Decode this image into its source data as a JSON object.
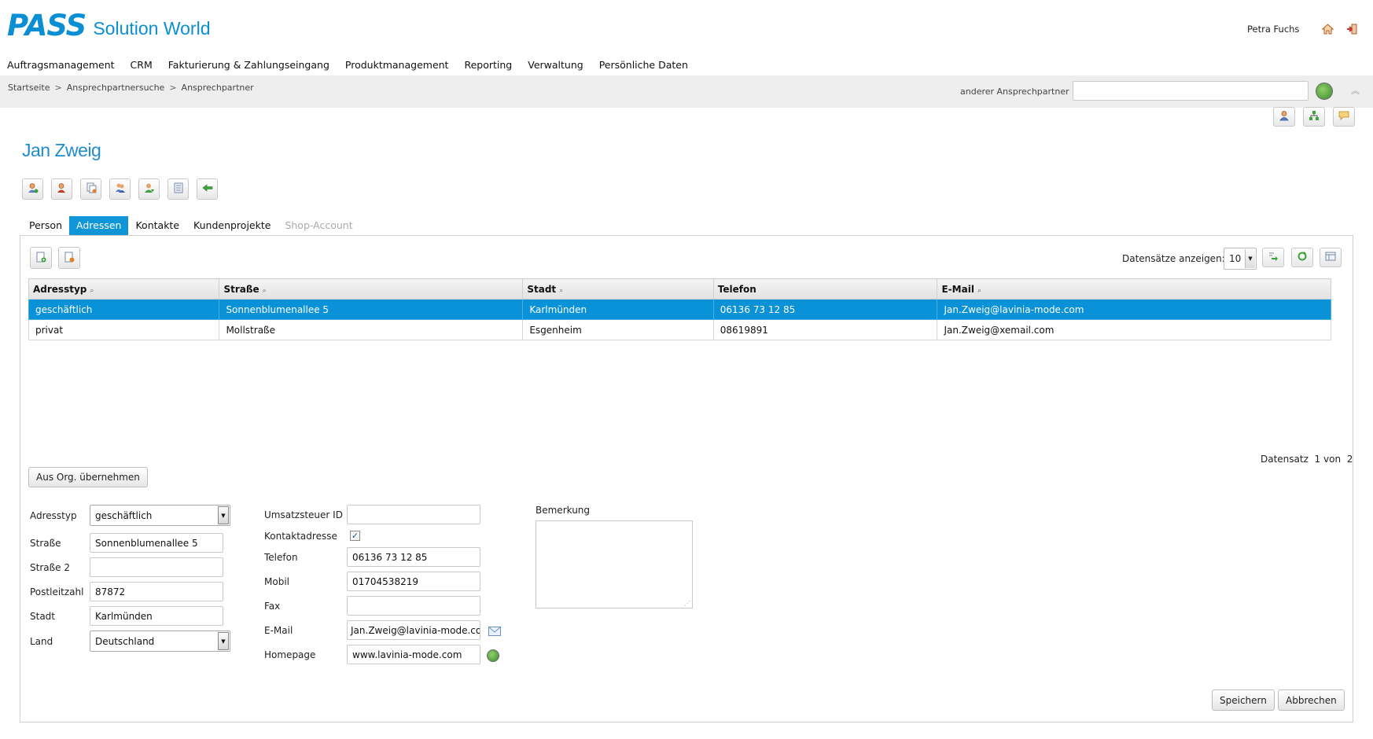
{
  "header": {
    "logo_mark": "PASS",
    "logo_text": "Solution World",
    "user_name": "Petra Fuchs",
    "home_icon": "home-icon",
    "logout_icon": "logout-icon"
  },
  "nav": {
    "items": [
      "Auftragsmanagement",
      "CRM",
      "Fakturierung & Zahlungseingang",
      "Produktmanagement",
      "Reporting",
      "Verwaltung",
      "Persönliche Daten"
    ]
  },
  "breadcrumb": {
    "items": [
      "Startseite",
      "Ansprechpartnersuche",
      "Ansprechpartner"
    ],
    "separator": ">"
  },
  "other_contact": {
    "label": "anderer Ansprechpartner",
    "value": ""
  },
  "page": {
    "title": "Jan Zweig"
  },
  "tabs": [
    {
      "label": "Person",
      "state": "normal"
    },
    {
      "label": "Adressen",
      "state": "active"
    },
    {
      "label": "Kontakte",
      "state": "normal"
    },
    {
      "label": "Kundenprojekte",
      "state": "normal"
    },
    {
      "label": "Shop-Account",
      "state": "disabled"
    }
  ],
  "grid": {
    "records_label": "Datensätze anzeigen:",
    "records_value": "10",
    "columns": [
      "Adresstyp",
      "Straße",
      "Stadt",
      "Telefon",
      "E-Mail"
    ],
    "sortable": [
      true,
      true,
      true,
      false,
      true
    ],
    "sort_glyph": "⌕",
    "rows": [
      {
        "type": "geschäftlich",
        "street": "Sonnenblumenallee 5",
        "city": "Karlmünden",
        "phone": "06136 73 12 85",
        "email": "Jan.Zweig@lavinia-mode.com",
        "selected": true
      },
      {
        "type": "privat",
        "street": "Mollstraße",
        "city": "Esgenheim",
        "phone": "08619891",
        "email": "Jan.Zweig@xemail.com",
        "selected": false
      }
    ],
    "record_count_label": "Datensatz",
    "record_count_current": "1",
    "record_count_of": "von",
    "record_count_total": "2"
  },
  "from_org_button": "Aus Org. übernehmen",
  "form": {
    "address_type": {
      "label": "Adresstyp",
      "value": "geschäftlich"
    },
    "street": {
      "label": "Straße",
      "value": "Sonnenblumenallee 5"
    },
    "street2": {
      "label": "Straße 2",
      "value": ""
    },
    "zip": {
      "label": "Postleitzahl",
      "value": "87872"
    },
    "city": {
      "label": "Stadt",
      "value": "Karlmünden"
    },
    "country": {
      "label": "Land",
      "value": "Deutschland"
    },
    "vat_id": {
      "label": "Umsatzsteuer ID",
      "value": ""
    },
    "contact_address": {
      "label": "Kontaktadresse",
      "checked": true,
      "check_glyph": "✓"
    },
    "phone": {
      "label": "Telefon",
      "value": "06136 73 12 85"
    },
    "mobile": {
      "label": "Mobil",
      "value": "01704538219"
    },
    "fax": {
      "label": "Fax",
      "value": ""
    },
    "email": {
      "label": "E-Mail",
      "value": "Jan.Zweig@lavinia-mode.com"
    },
    "homepage": {
      "label": "Homepage",
      "value": "www.lavinia-mode.com"
    },
    "remark": {
      "label": "Bemerkung",
      "value": ""
    }
  },
  "buttons": {
    "save": "Speichern",
    "cancel": "Abbrechen"
  },
  "colors": {
    "brand": "#0b8fd4",
    "active_tab": "#0e96d8",
    "selected_row": "#0a92d9"
  }
}
